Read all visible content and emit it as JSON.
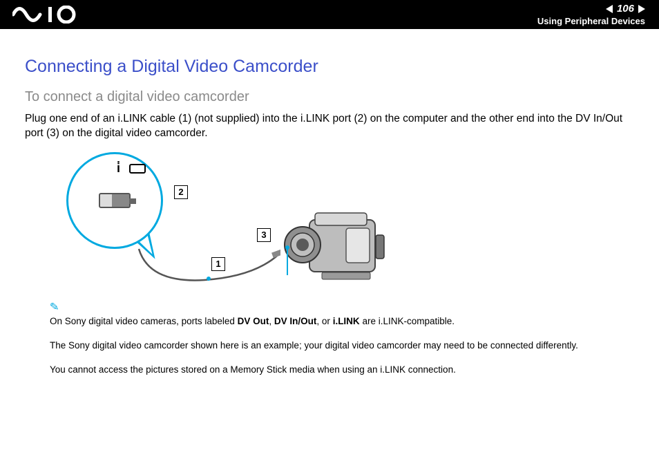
{
  "header": {
    "page_number": "106",
    "section": "Using Peripheral Devices"
  },
  "content": {
    "title": "Connecting a Digital Video Camcorder",
    "subtitle": "To connect a digital video camcorder",
    "body": "Plug one end of an i.LINK cable (1) (not supplied) into the i.LINK port (2) on the computer and the other end into the DV In/Out port (3) on the digital video camcorder."
  },
  "diagram": {
    "callout_1": "1",
    "callout_2": "2",
    "callout_3": "3"
  },
  "notes": {
    "n1_pre": "On Sony digital video cameras, ports labeled ",
    "n1_b1": "DV Out",
    "n1_m1": ", ",
    "n1_b2": "DV In/Out",
    "n1_m2": ", or ",
    "n1_b3": "i.LINK",
    "n1_post": " are i.LINK-compatible.",
    "n2": "The Sony digital video camcorder shown here is an example; your digital video camcorder may need to be connected differently.",
    "n3": "You cannot access the pictures stored on a Memory Stick media when using an i.LINK connection."
  }
}
